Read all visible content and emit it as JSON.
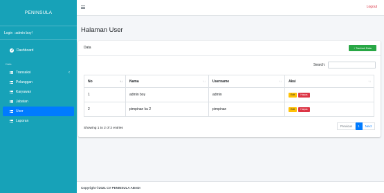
{
  "sidebar": {
    "brand": "PENINSULA",
    "user": "Login : admin boy!",
    "dashboard": "Dashboard",
    "section_header": "Data",
    "items": [
      {
        "label": "Transaksi",
        "has_children": true
      },
      {
        "label": "Pelanggan"
      },
      {
        "label": "Karyawan"
      },
      {
        "label": "Jabatan"
      },
      {
        "label": "User",
        "active": true
      },
      {
        "label": "Laporan"
      }
    ],
    "bg_color": "#17a2b8",
    "active_color": "#007bff"
  },
  "topbar": {
    "logout_label": "Logout"
  },
  "page": {
    "title": "Halaman User"
  },
  "card": {
    "title": "Data",
    "add_button_label": "+ Tambah Data",
    "search_label": "Search:",
    "search_value": "",
    "table": {
      "columns": [
        "No",
        "Nama",
        "Username",
        "Aksi"
      ],
      "rows": [
        {
          "no": "1",
          "nama": "admin boy",
          "username": "admin",
          "edit": "Edit",
          "delete": "Hapus"
        },
        {
          "no": "2",
          "nama": "pimpinan ku 2",
          "username": "pimpinan",
          "edit": "Edit",
          "delete": "Hapus"
        }
      ]
    },
    "info": "Showing 1 to 2 of 2 entries",
    "pagination": {
      "previous": "Previous",
      "current": "1",
      "next": "Next"
    }
  },
  "footer": {
    "text": "Copyright ©2021 CV PENINSULA ABADI"
  }
}
